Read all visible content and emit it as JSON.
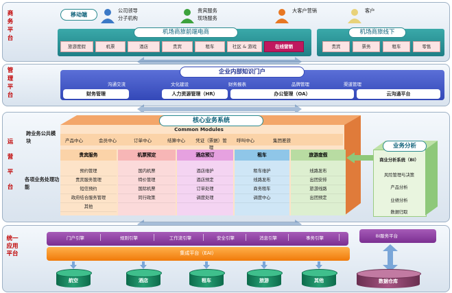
{
  "layers": {
    "business": "商务平台",
    "management": "管理平台",
    "operations": "运营平台",
    "integration": "统一应用平台"
  },
  "mobile": {
    "title": "移动端",
    "users": [
      {
        "label": "公司领导\n分子机构",
        "icon": "person-blue-icon",
        "color": "#3b79c6"
      },
      {
        "label": "贵宾服务\n现场服务",
        "icon": "person-green-icon",
        "color": "#3ca23c"
      },
      {
        "label": "大客户营销",
        "icon": "person-orange-icon",
        "color": "#e87722"
      },
      {
        "label": "客户",
        "icon": "person-yellow-icon",
        "color": "#e8d27a"
      }
    ]
  },
  "online": {
    "title": "机场商旅前端电商",
    "tabs": [
      "旅游度假",
      "机票",
      "酒店",
      "贵宾",
      "租车",
      "社区 & 游戏",
      "在线营销"
    ]
  },
  "offline": {
    "title": "机场商旅线下",
    "tabs": [
      "贵宾",
      "票务",
      "租车",
      "零售"
    ]
  },
  "portal": {
    "title": "企业内部知识门户",
    "sub": [
      "沟通交流",
      "文化建设",
      "财务报表",
      "品牌管理",
      "渠道管理"
    ],
    "modules": [
      "财务管理",
      "人力资源管理（HR）",
      "办公管理（OA）",
      "云沟通平台"
    ]
  },
  "core": {
    "title": "核心业务系统",
    "common_label": "跨业务公共模块",
    "common_title": "Common Modules",
    "common_items": [
      "产品中心",
      "会员中心",
      "订单中心",
      "结算中心",
      "凭证（票据）管理",
      "呼叫中心",
      "集团差旅"
    ],
    "biz_label": "各项业务处理功能",
    "columns": [
      {
        "head": "贵宾服务",
        "items": [
          "预约管理",
          "贵宾服务管理",
          "短信预约",
          "政府结合服务管理",
          "其他"
        ]
      },
      {
        "head": "机票预定",
        "items": [
          "国内机票",
          "特价管理",
          "国际机票",
          "同行政策"
        ]
      },
      {
        "head": "酒店预订",
        "items": [
          "酒店维护",
          "酒店预定",
          "订单处理",
          "调度处理"
        ]
      },
      {
        "head": "租车",
        "items": [
          "租车维护",
          "线路发布",
          "商务租车",
          "调度中心"
        ]
      },
      {
        "head": "旅游度假",
        "items": [
          "线路发布",
          "出团安排",
          "旅游线路",
          "出团预定"
        ]
      }
    ]
  },
  "analysis": {
    "title": "业务分析",
    "items": [
      "商业分析系统（BI）",
      "风险管理与决策",
      "产品分析",
      "业绩分析",
      "数据归取"
    ]
  },
  "engines": {
    "items": [
      "门户引擎",
      "规则引擎",
      "工作流引擎",
      "安全引擎",
      "消息引擎",
      "事务引擎"
    ],
    "bi_service": "BI服务平台",
    "eai": "集成平台（EAI）"
  },
  "databases": [
    "航空",
    "酒店",
    "租车",
    "旅游",
    "其他"
  ],
  "warehouse": "数据仓库"
}
